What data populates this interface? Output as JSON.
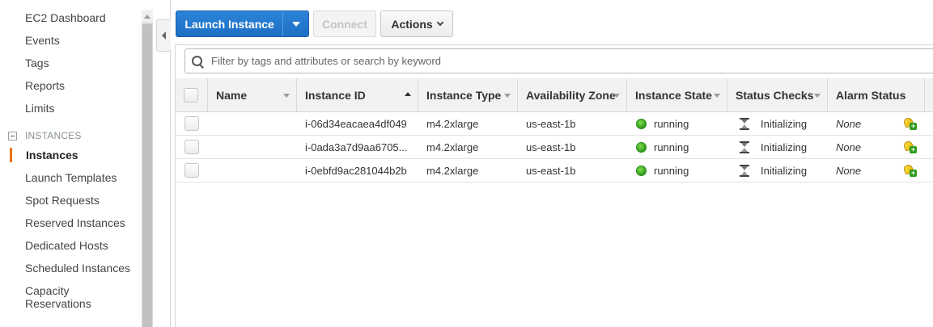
{
  "sidebar": {
    "items": [
      {
        "label": "EC2 Dashboard"
      },
      {
        "label": "Events"
      },
      {
        "label": "Tags"
      },
      {
        "label": "Reports"
      },
      {
        "label": "Limits"
      }
    ],
    "section_label": "INSTANCES",
    "section_items": [
      {
        "label": "Instances"
      },
      {
        "label": "Launch Templates"
      },
      {
        "label": "Spot Requests"
      },
      {
        "label": "Reserved Instances"
      },
      {
        "label": "Dedicated Hosts"
      },
      {
        "label": "Scheduled Instances"
      },
      {
        "label": "Capacity Reservations"
      }
    ],
    "active_item": "Instances"
  },
  "toolbar": {
    "launch_label": "Launch Instance",
    "connect_label": "Connect",
    "actions_label": "Actions"
  },
  "search": {
    "placeholder": "Filter by tags and attributes or search by keyword",
    "value": ""
  },
  "table": {
    "columns": [
      "Name",
      "Instance ID",
      "Instance Type",
      "Availability Zone",
      "Instance State",
      "Status Checks",
      "Alarm Status"
    ],
    "rows": [
      {
        "name": "",
        "instance_id": "i-06d34eacaea4df049",
        "instance_type": "m4.2xlarge",
        "az": "us-east-1b",
        "state": "running",
        "status_checks": "Initializing",
        "alarm_status": "None"
      },
      {
        "name": "",
        "instance_id": "i-0ada3a7d9aa6705...",
        "instance_type": "m4.2xlarge",
        "az": "us-east-1b",
        "state": "running",
        "status_checks": "Initializing",
        "alarm_status": "None"
      },
      {
        "name": "",
        "instance_id": "i-0ebfd9ac281044b2b",
        "instance_type": "m4.2xlarge",
        "az": "us-east-1b",
        "state": "running",
        "status_checks": "Initializing",
        "alarm_status": "None"
      }
    ]
  },
  "colors": {
    "accent_blue": "#1e6fc4",
    "active_marker": "#ec7211",
    "running_green": "#2e9b1d"
  },
  "icons": [
    "search-icon",
    "collapse-icon",
    "caret-down-icon",
    "chevron-down-icon",
    "sort-icon",
    "status-running-icon",
    "hourglass-icon",
    "alarm-add-icon"
  ]
}
